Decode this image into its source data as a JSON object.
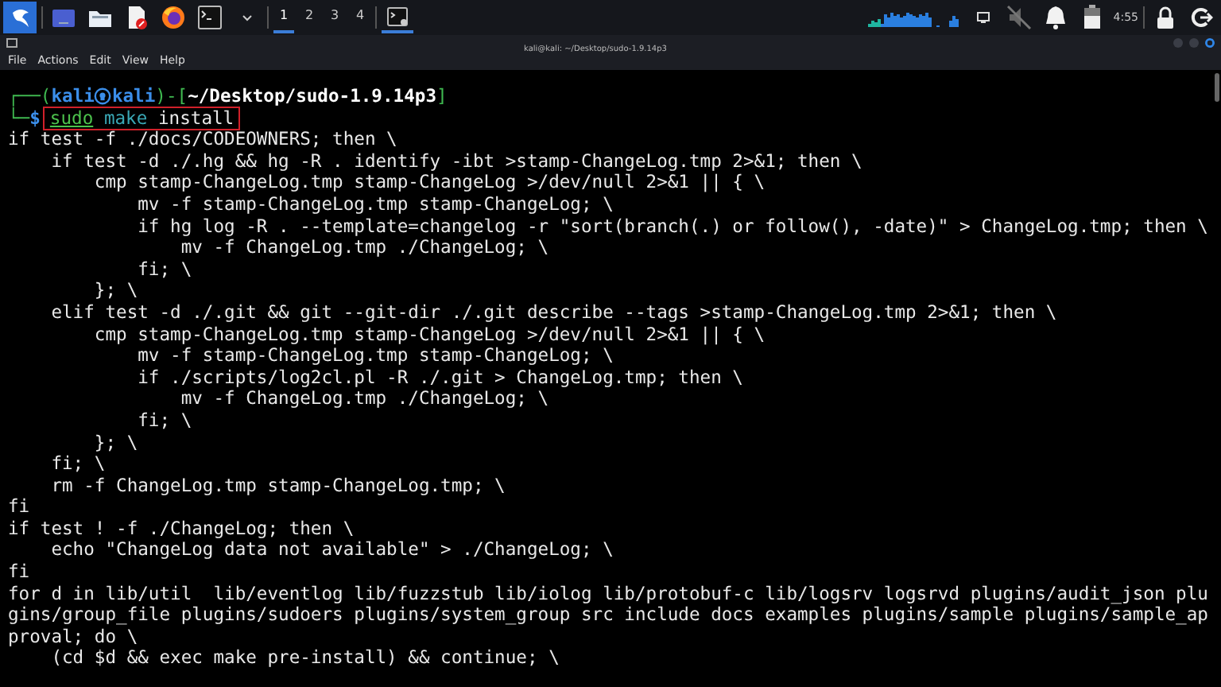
{
  "taskbar": {
    "workspaces": [
      {
        "label": "1",
        "selected": true
      },
      {
        "label": "2",
        "selected": false
      },
      {
        "label": "3",
        "selected": false
      },
      {
        "label": "4",
        "selected": false
      }
    ],
    "clock": "4:55",
    "speaker_muted": true
  },
  "window": {
    "title": "kali@kali: ~/Desktop/sudo-1.9.14p3",
    "menu": [
      "File",
      "Actions",
      "Edit",
      "View",
      "Help"
    ]
  },
  "terminal": {
    "prompt": {
      "open": "┌──(",
      "user": "kali",
      "host": "kali",
      "mid": ")-[",
      "path": "~/Desktop/sudo-1.9.14p3",
      "close": "]",
      "corner": "└─",
      "sign": "$"
    },
    "command": {
      "highlighted": true,
      "tokens": [
        {
          "text": "sudo",
          "color": "#4cc24c",
          "underline": true
        },
        {
          "text": "make",
          "color": "#3aa7b5",
          "underline": false
        },
        {
          "text": "install",
          "color": "#e8e8e8",
          "underline": false
        }
      ]
    },
    "output_lines": [
      "if test -f ./docs/CODEOWNERS; then \\",
      "    if test -d ./.hg && hg -R . identify -ibt >stamp-ChangeLog.tmp 2>&1; then \\",
      "        cmp stamp-ChangeLog.tmp stamp-ChangeLog >/dev/null 2>&1 || { \\",
      "            mv -f stamp-ChangeLog.tmp stamp-ChangeLog; \\",
      "            if hg log -R . --template=changelog -r \"sort(branch(.) or follow(), -date)\" > ChangeLog.tmp; then \\",
      "                mv -f ChangeLog.tmp ./ChangeLog; \\",
      "            fi; \\",
      "        }; \\",
      "    elif test -d ./.git && git --git-dir ./.git describe --tags >stamp-ChangeLog.tmp 2>&1; then \\",
      "        cmp stamp-ChangeLog.tmp stamp-ChangeLog >/dev/null 2>&1 || { \\",
      "            mv -f stamp-ChangeLog.tmp stamp-ChangeLog; \\",
      "            if ./scripts/log2cl.pl -R ./.git > ChangeLog.tmp; then \\",
      "                mv -f ChangeLog.tmp ./ChangeLog; \\",
      "            fi; \\",
      "        }; \\",
      "    fi; \\",
      "    rm -f ChangeLog.tmp stamp-ChangeLog.tmp; \\",
      "fi",
      "if test ! -f ./ChangeLog; then \\",
      "    echo \"ChangeLog data not available\" > ./ChangeLog; \\",
      "fi",
      "for d in lib/util  lib/eventlog lib/fuzzstub lib/iolog lib/protobuf-c lib/logsrv logsrvd plugins/audit_json plu",
      "gins/group_file plugins/sudoers plugins/system_group src include docs examples plugins/sample plugins/sample_ap",
      "proval; do \\",
      "    (cd $d && exec make pre-install) && continue; \\"
    ]
  }
}
